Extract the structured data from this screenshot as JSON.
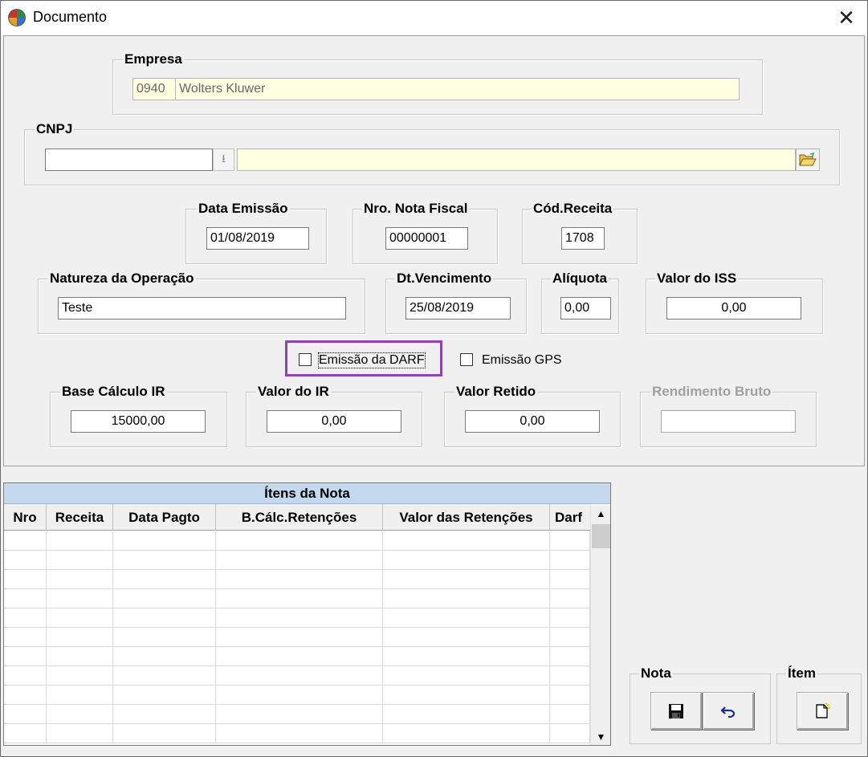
{
  "window": {
    "title": "Documento",
    "close_glyph": "✕"
  },
  "empresa": {
    "legend": "Empresa",
    "code": "0940",
    "name": "Wolters Kluwer"
  },
  "cnpj": {
    "legend": "CNPJ",
    "value": "",
    "description": ""
  },
  "data_emissao": {
    "legend": "Data Emissão",
    "value": "01/08/2019"
  },
  "nro_nota": {
    "legend": "Nro. Nota Fiscal",
    "value": "00000001"
  },
  "cod_receita": {
    "legend": "Cód.Receita",
    "value": "1708"
  },
  "natureza": {
    "legend": "Natureza da Operação",
    "value": "Teste"
  },
  "dt_vencimento": {
    "legend": "Dt.Vencimento",
    "value": "25/08/2019"
  },
  "aliquota": {
    "legend": "Alíquota",
    "value": "0,00"
  },
  "valor_iss": {
    "legend": "Valor do ISS",
    "value": "0,00"
  },
  "checks": {
    "darf": {
      "label": "Emissão da DARF",
      "checked": false
    },
    "gps": {
      "label": "Emissão GPS",
      "checked": false
    }
  },
  "base_ir": {
    "legend": "Base Cálculo IR",
    "value": "15000,00"
  },
  "valor_ir": {
    "legend": "Valor do IR",
    "value": "0,00"
  },
  "valor_retido": {
    "legend": "Valor Retido",
    "value": "0,00"
  },
  "rendimento_bruto": {
    "legend": "Rendimento Bruto",
    "value": ""
  },
  "grid": {
    "caption": "Ítens da Nota",
    "columns": [
      "Nro",
      "Receita",
      "Data Pagto",
      "B.Cálc.Retenções",
      "Valor das Retenções",
      "Darf"
    ]
  },
  "nota": {
    "legend": "Nota",
    "save_icon": "save-icon",
    "undo_icon": "undo-icon"
  },
  "item": {
    "legend": "Ítem",
    "new_icon": "new-document-icon"
  },
  "colors": {
    "focus": "#8e44ad",
    "caption_bg": "#c5d9ee",
    "readonly_bg": "#ffffe1"
  }
}
